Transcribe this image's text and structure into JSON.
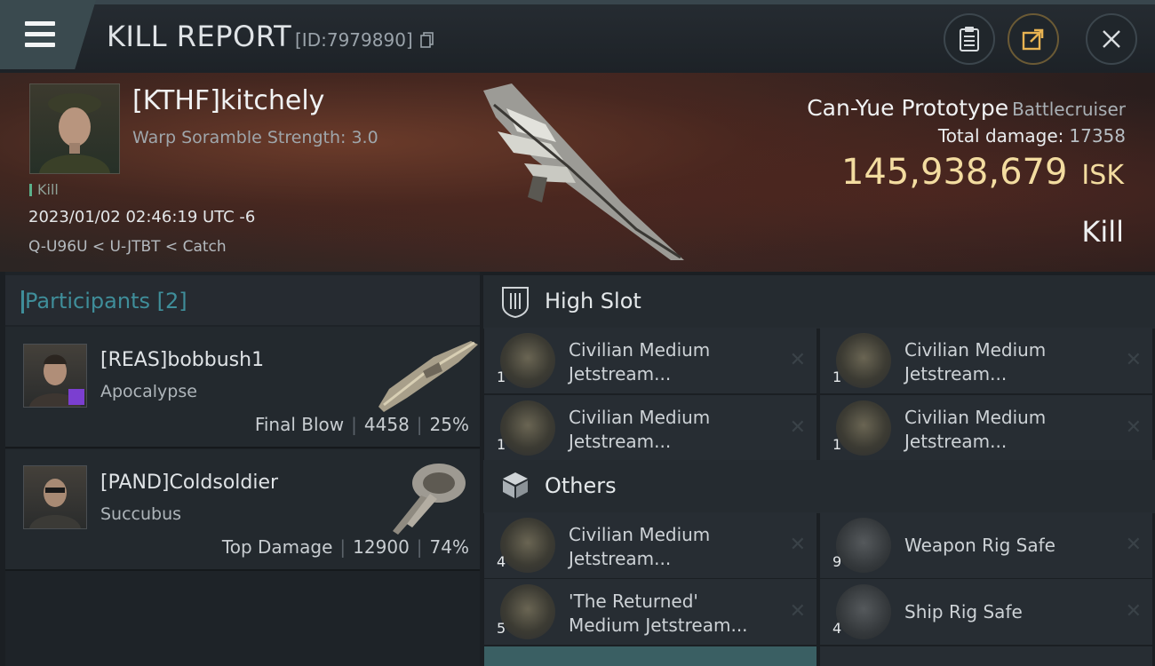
{
  "header": {
    "title": "KILL REPORT",
    "kill_id": "[ID:7979890]",
    "icons": {
      "menu": "hamburger-menu-icon",
      "copy": "copy-icon",
      "clipboard": "clipboard-icon",
      "share": "share-icon",
      "close": "close-icon"
    }
  },
  "victim": {
    "name": "[KTHF]kitchely",
    "warp_scramble": "Warp Soramble Strength: 3.0",
    "tag": "Kill",
    "date": "2023/01/02 02:46:19 UTC -6",
    "location": "Q-U96U < U-JTBT < Catch",
    "ship_name": "Can-Yue Prototype",
    "ship_class": "Battlecruiser",
    "total_damage_label": "Total damage:",
    "total_damage": "17358",
    "isk_value": "145,938,679",
    "isk_unit": "ISK",
    "result": "Kill"
  },
  "participants": {
    "title": "Participants",
    "count": "[2]",
    "items": [
      {
        "name": "[REAS]bobbush1",
        "ship": "Apocalypse",
        "role": "Final Blow",
        "damage": "4458",
        "percent": "25%"
      },
      {
        "name": "[PAND]Coldsoldier",
        "ship": "Succubus",
        "role": "Top Damage",
        "damage": "12900",
        "percent": "74%"
      }
    ]
  },
  "high_slot": {
    "title": "High Slot",
    "items": [
      {
        "qty": "1",
        "line1": "Civilian Medium",
        "line2": "Jetstream..."
      },
      {
        "qty": "1",
        "line1": "Civilian Medium",
        "line2": "Jetstream..."
      },
      {
        "qty": "1",
        "line1": "Civilian Medium",
        "line2": "Jetstream..."
      },
      {
        "qty": "1",
        "line1": "Civilian Medium",
        "line2": "Jetstream..."
      }
    ]
  },
  "others": {
    "title": "Others",
    "items": [
      {
        "qty": "4",
        "line1": "Civilian Medium",
        "line2": "Jetstream..."
      },
      {
        "qty": "9",
        "line1": "Weapon Rig Safe",
        "line2": ""
      },
      {
        "qty": "5",
        "line1": "'The Returned'",
        "line2": "Medium Jetstream..."
      },
      {
        "qty": "4",
        "line1": "Ship Rig Safe",
        "line2": ""
      }
    ]
  },
  "remove_glyph": "✕"
}
